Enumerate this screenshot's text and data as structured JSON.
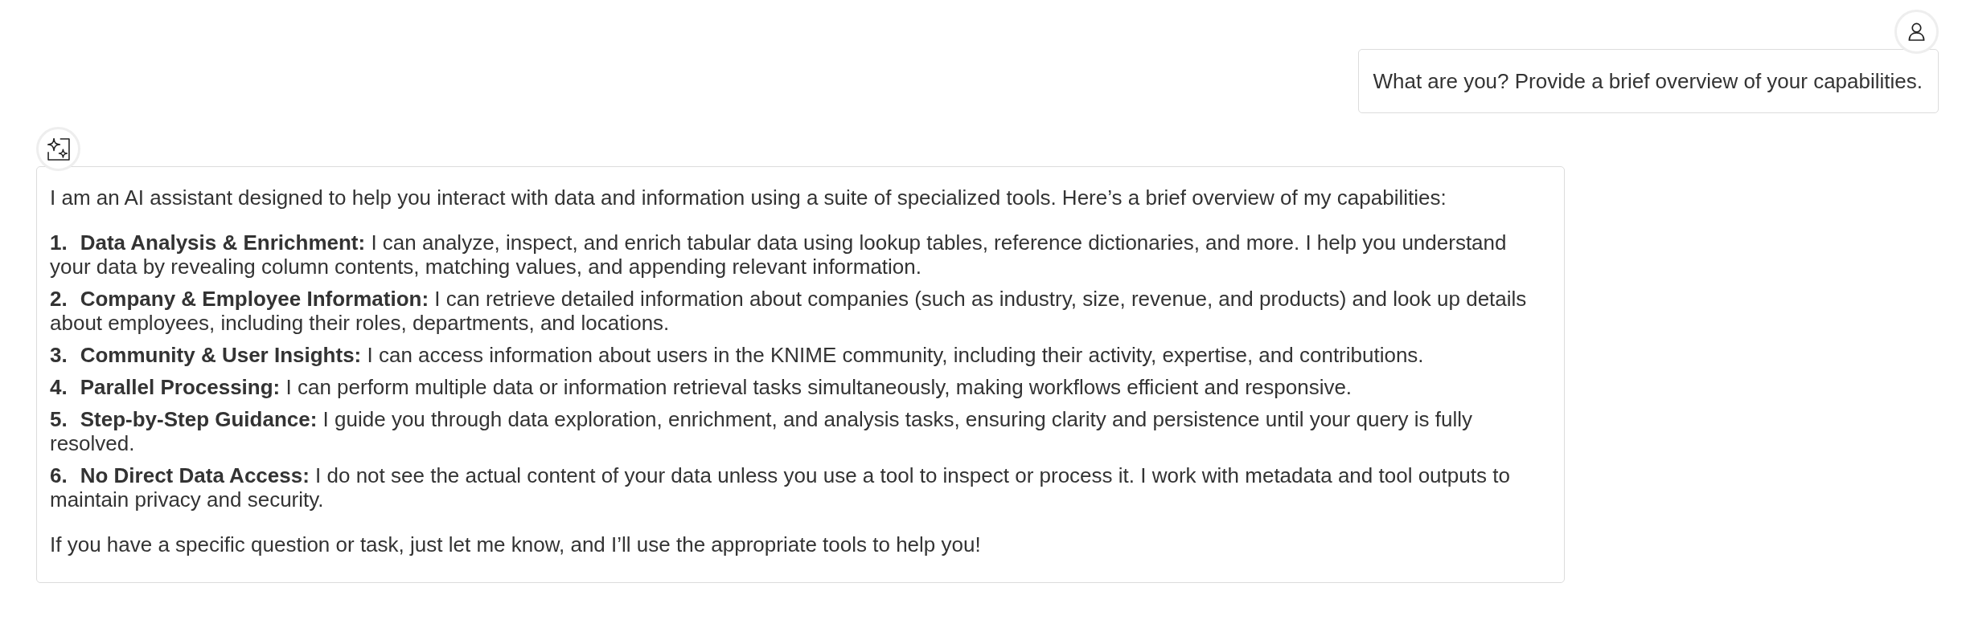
{
  "user_message": {
    "text": "What are you? Provide a brief overview of your capabilities."
  },
  "assistant_message": {
    "intro": "I am an AI assistant designed to help you interact with data and information using a suite of specialized tools. Here’s a brief overview of my capabilities:",
    "items": [
      {
        "number": "1.",
        "title": "Data Analysis & Enrichment:",
        "text": "I can analyze, inspect, and enrich tabular data using lookup tables, reference dictionaries, and more. I help you understand your data by revealing column contents, matching values, and appending relevant information."
      },
      {
        "number": "2.",
        "title": "Company & Employee Information:",
        "text": "I can retrieve detailed information about companies (such as industry, size, revenue, and products) and look up details about employees, including their roles, departments, and locations."
      },
      {
        "number": "3.",
        "title": "Community & User Insights:",
        "text": "I can access information about users in the KNIME community, including their activity, expertise, and contributions."
      },
      {
        "number": "4.",
        "title": "Parallel Processing:",
        "text": "I can perform multiple data or information retrieval tasks simultaneously, making workflows efficient and responsive."
      },
      {
        "number": "5.",
        "title": "Step-by-Step Guidance:",
        "text": "I guide you through data exploration, enrichment, and analysis tasks, ensuring clarity and persistence until your query is fully resolved."
      },
      {
        "number": "6.",
        "title": "No Direct Data Access:",
        "text": "I do not see the actual content of your data unless you use a tool to inspect or process it. I work with metadata and tool outputs to maintain privacy and security."
      }
    ],
    "outro": "If you have a specific question or task, just let me know, and I’ll use the appropriate tools to help you!"
  }
}
